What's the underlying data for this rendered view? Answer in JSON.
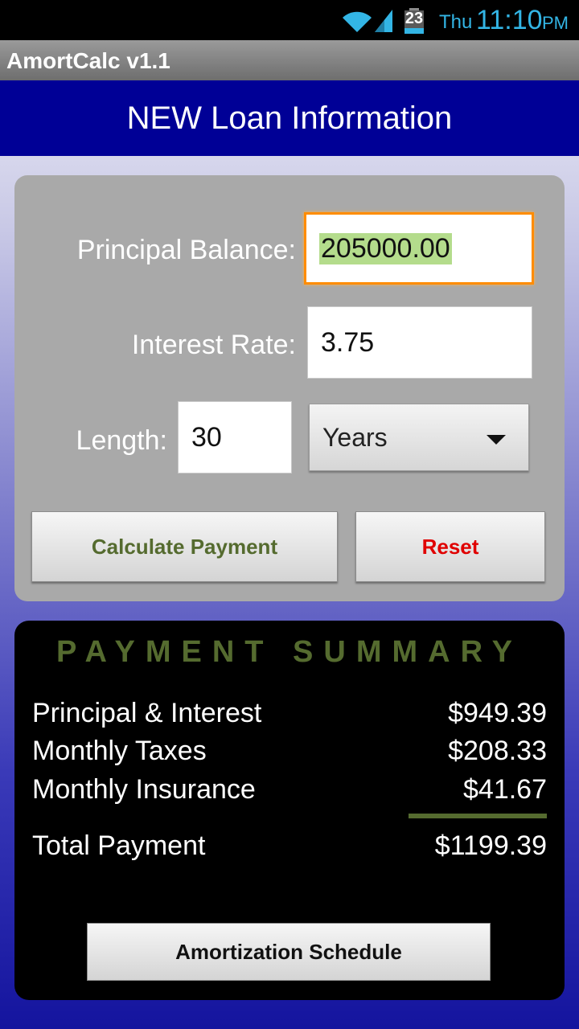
{
  "status_bar": {
    "battery_level": "23",
    "day": "Thu",
    "time": "11:10",
    "ampm": "PM",
    "icons": [
      "wifi-icon",
      "signal-icon",
      "battery-icon"
    ]
  },
  "app": {
    "title": "AmortCalc v1.1"
  },
  "header": {
    "title": "NEW Loan Information"
  },
  "form": {
    "principal_label": "Principal Balance:",
    "principal_value": "205000.00",
    "interest_label": "Interest Rate:",
    "interest_value": "3.75",
    "length_label": "Length:",
    "length_value": "30",
    "length_unit": "Years",
    "calculate_label": "Calculate Payment",
    "reset_label": "Reset"
  },
  "summary": {
    "title": "PAYMENT SUMMARY",
    "rows": [
      {
        "label": "Principal & Interest",
        "value": "$949.39"
      },
      {
        "label": "Monthly Taxes",
        "value": "$208.33"
      },
      {
        "label": "Monthly Insurance",
        "value": "$41.67"
      }
    ],
    "total_label": "Total Payment",
    "total_value": "$1199.39",
    "schedule_label": "Amortization Schedule"
  },
  "colors": {
    "header_blue": "#000096",
    "focus_orange": "#ff8c00",
    "calc_text": "#556b2f",
    "reset_text": "#e00000",
    "status_blue": "#33b5e5"
  }
}
